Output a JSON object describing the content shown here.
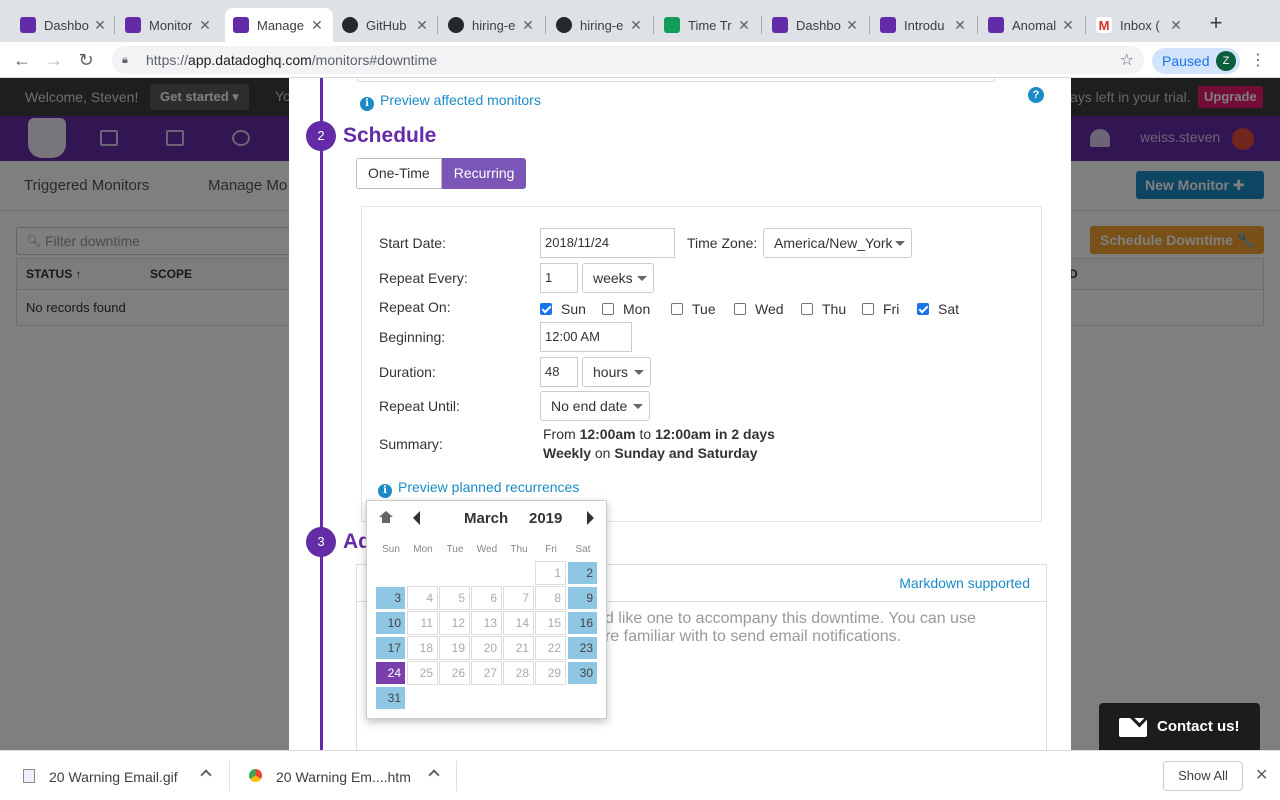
{
  "browser": {
    "tabs": [
      {
        "title": "Dashbo",
        "icon": "datadog-icon"
      },
      {
        "title": "Monitor",
        "icon": "datadog-icon"
      },
      {
        "title": "Manage",
        "icon": "datadog-icon",
        "active": true
      },
      {
        "title": "GitHub",
        "icon": "github-icon"
      },
      {
        "title": "hiring-e",
        "icon": "github-icon"
      },
      {
        "title": "hiring-e",
        "icon": "github-icon"
      },
      {
        "title": "Time Tr",
        "icon": "sheets-icon"
      },
      {
        "title": "Dashbo",
        "icon": "datadog-icon"
      },
      {
        "title": "Introdu",
        "icon": "datadog-icon"
      },
      {
        "title": "Anomal",
        "icon": "datadog-icon"
      },
      {
        "title": "Inbox (",
        "icon": "gmail-icon"
      }
    ],
    "url_scheme": "https://",
    "url_host": "app.datadoghq.com",
    "url_path": "/monitors#downtime",
    "profile_status": "Paused",
    "profile_initial": "Z"
  },
  "page": {
    "welcome": "Welcome, Steven!",
    "get_started": "Get started ▾",
    "yo_fragment": "Yo",
    "trial_text": "ays left in your trial.",
    "upgrade": "Upgrade",
    "username": "weiss.steven",
    "subnav": [
      "Triggered Monitors",
      "Manage Mo"
    ],
    "new_monitor": "New Monitor ✚",
    "filter_placeholder": "Filter downtime",
    "schedule_downtime": "Schedule Downtime 🔧",
    "table_headers": [
      "STATUS ↑",
      "SCOPE",
      "D"
    ],
    "no_records": "No records found"
  },
  "modal": {
    "preview_affected": "Preview affected monitors",
    "help": "?",
    "step2_number": "2",
    "step2_title": "Schedule",
    "type_options": [
      "One-Time",
      "Recurring"
    ],
    "selected_type": "Recurring",
    "form": {
      "start_date_label": "Start Date:",
      "start_date": "2018/11/24",
      "timezone_label": "Time Zone:",
      "timezone": "America/New_York",
      "repeat_every_label": "Repeat Every:",
      "repeat_every": "1",
      "repeat_unit": "weeks",
      "repeat_on_label": "Repeat On:",
      "days": [
        {
          "label": "Sun",
          "checked": true
        },
        {
          "label": "Mon",
          "checked": false
        },
        {
          "label": "Tue",
          "checked": false
        },
        {
          "label": "Wed",
          "checked": false
        },
        {
          "label": "Thu",
          "checked": false
        },
        {
          "label": "Fri",
          "checked": false
        },
        {
          "label": "Sat",
          "checked": true
        }
      ],
      "beginning_label": "Beginning:",
      "beginning": "12:00 AM",
      "duration_label": "Duration:",
      "duration": "48",
      "duration_unit": "hours",
      "repeat_until_label": "Repeat Until:",
      "repeat_until": "No end date",
      "summary_label": "Summary:",
      "summary": {
        "from_word": "From",
        "from_time": "12:00am",
        "to_word": "to",
        "to_time": "12:00am in 2 days",
        "freq": "Weekly",
        "on_word": "on",
        "days": "Sunday and Saturday"
      }
    },
    "preview_planned": "Preview planned recurrences",
    "step3_number": "3",
    "step3_title": "Ad",
    "markdown": "Markdown supported",
    "message_placeholder_line1": "u'd like one to accompany this downtime. You can use",
    "message_placeholder_line2": "u're familiar with to send email notifications."
  },
  "datepicker": {
    "month": "March",
    "year": "2019",
    "dow": [
      "Sun",
      "Mon",
      "Tue",
      "Wed",
      "Thu",
      "Fri",
      "Sat"
    ],
    "weeks": [
      [
        null,
        null,
        null,
        null,
        null,
        "1",
        "2"
      ],
      [
        "3",
        "4",
        "5",
        "6",
        "7",
        "8",
        "9"
      ],
      [
        "10",
        "11",
        "12",
        "13",
        "14",
        "15",
        "16"
      ],
      [
        "17",
        "18",
        "19",
        "20",
        "21",
        "22",
        "23"
      ],
      [
        "24",
        "25",
        "26",
        "27",
        "28",
        "29",
        "30"
      ],
      [
        "31",
        null,
        null,
        null,
        null,
        null,
        null
      ]
    ],
    "enabled_days": [
      "2",
      "3",
      "9",
      "10",
      "16",
      "17",
      "23",
      "30",
      "31"
    ],
    "today": "24"
  },
  "contact": "Contact us!",
  "downloads": {
    "items": [
      "20 Warning Email.gif",
      "20 Warning Em....htm"
    ],
    "show_all": "Show All"
  },
  "colors": {
    "datadog_purple": "#632ca6",
    "link_blue": "#1a8bc7",
    "enabled_day": "#8ec6e3",
    "selected_day": "#7b3fab"
  }
}
